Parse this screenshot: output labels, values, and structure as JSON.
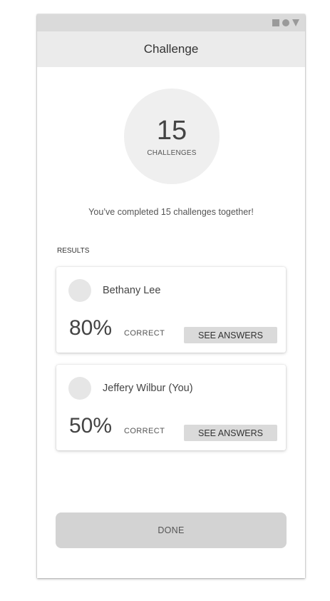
{
  "status_bar": {
    "icons": [
      "square-icon",
      "circle-icon",
      "triangle-icon"
    ]
  },
  "header": {
    "title": "Challenge"
  },
  "summary_stat": {
    "count": "15",
    "label": "CHALLENGES"
  },
  "summary_text": "You’ve completed 15 challenges together!",
  "results": {
    "heading": "RESULTS",
    "items": [
      {
        "name": "Bethany Lee",
        "percent": "80%",
        "percent_label": "CORRECT",
        "action_label": "SEE ANSWERS"
      },
      {
        "name": "Jeffery Wilbur (You)",
        "percent": "50%",
        "percent_label": "CORRECT",
        "action_label": "SEE ANSWERS"
      }
    ]
  },
  "footer": {
    "done_label": "DONE"
  },
  "colors": {
    "header_bg": "#ebebeb",
    "status_bar_bg": "#dadada",
    "button_bg": "#dadada",
    "done_bg": "#d3d3d3"
  }
}
